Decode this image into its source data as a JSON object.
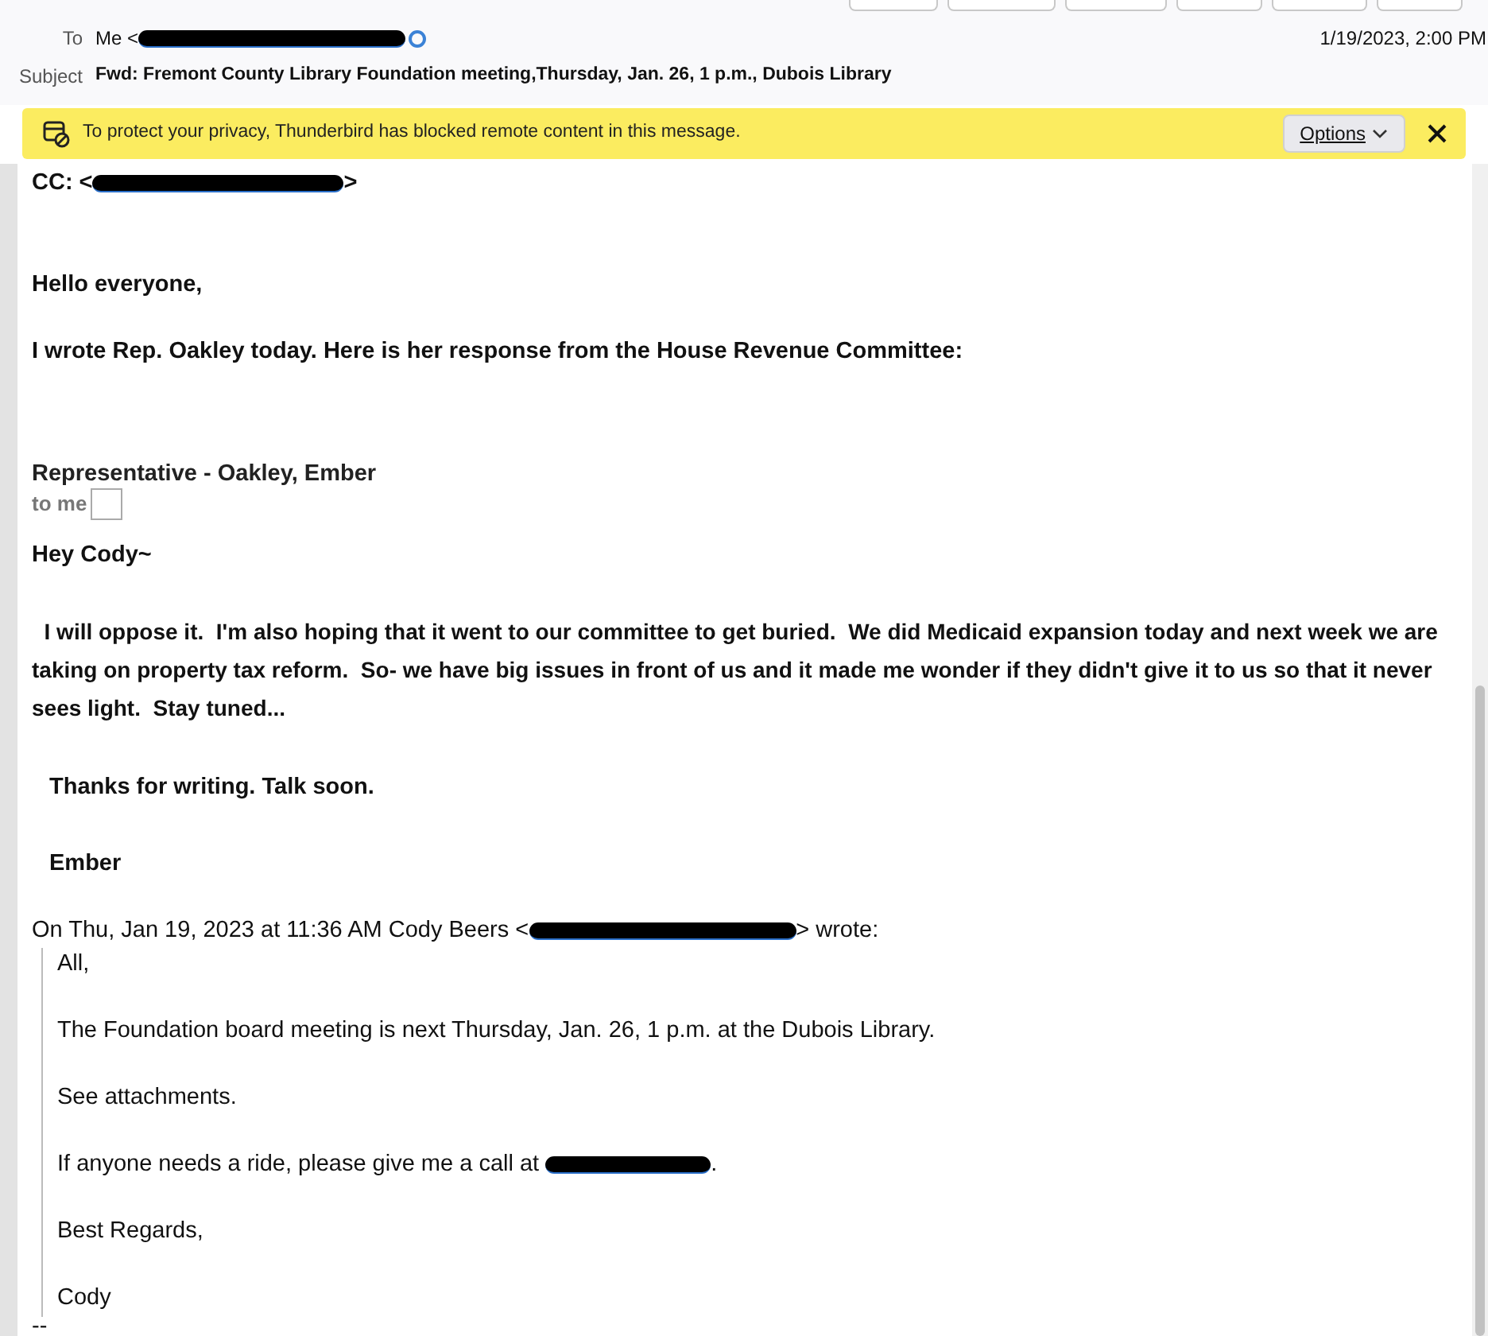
{
  "header": {
    "to_label": "To",
    "to_value": "Me <",
    "date": "1/19/2023, 2:00 PM",
    "subject_label": "Subject",
    "subject": "Fwd: Fremont County Library Foundation meeting,Thursday, Jan. 26, 1 p.m., Dubois Library"
  },
  "notification": {
    "text": "To protect your privacy, Thunderbird has blocked remote content in this message.",
    "button": "Options"
  },
  "body": [
    {
      "kind": "cc",
      "before": "CC: <",
      "after": ">"
    },
    {
      "kind": "bold",
      "text": "Hello everyone,"
    },
    {
      "kind": "bold",
      "text": "I wrote Rep. Oakley today. Here is her response from the House Revenue Committee:"
    },
    {
      "kind": "sender",
      "text": "Representative - Oakley, Ember"
    },
    {
      "kind": "tome",
      "text": "to me"
    },
    {
      "kind": "bold",
      "text": "Hey Cody~"
    },
    {
      "kind": "boldpara",
      "text": "  I will oppose it.  I'm also hoping that it went to our committee to get buried.  We did Medicaid expansion today and next week we are taking on property tax reform.  So- we have big issues in front of us and it made me wonder if they didn't give it to us so that it never sees light.  Stay tuned..."
    },
    {
      "kind": "boldindent",
      "text": "Thanks for writing.  Talk soon."
    },
    {
      "kind": "boldindent",
      "text": "Ember"
    },
    {
      "kind": "attribution",
      "before": "On Thu, Jan 19, 2023 at 11:36 AM Cody Beers <",
      "after": "> wrote:"
    },
    {
      "kind": "quote",
      "lines": [
        {
          "text": "All,"
        },
        {
          "text": "The Foundation board meeting is next Thursday, Jan. 26, 1 p.m. at the Dubois Library."
        },
        {
          "text": "See attachments."
        },
        {
          "text": "If anyone needs a ride, please give me a call at ",
          "after": "."
        },
        {
          "text": "Best Regards,"
        },
        {
          "text": "Cody"
        }
      ]
    },
    {
      "kind": "sig",
      "text": "--"
    }
  ]
}
